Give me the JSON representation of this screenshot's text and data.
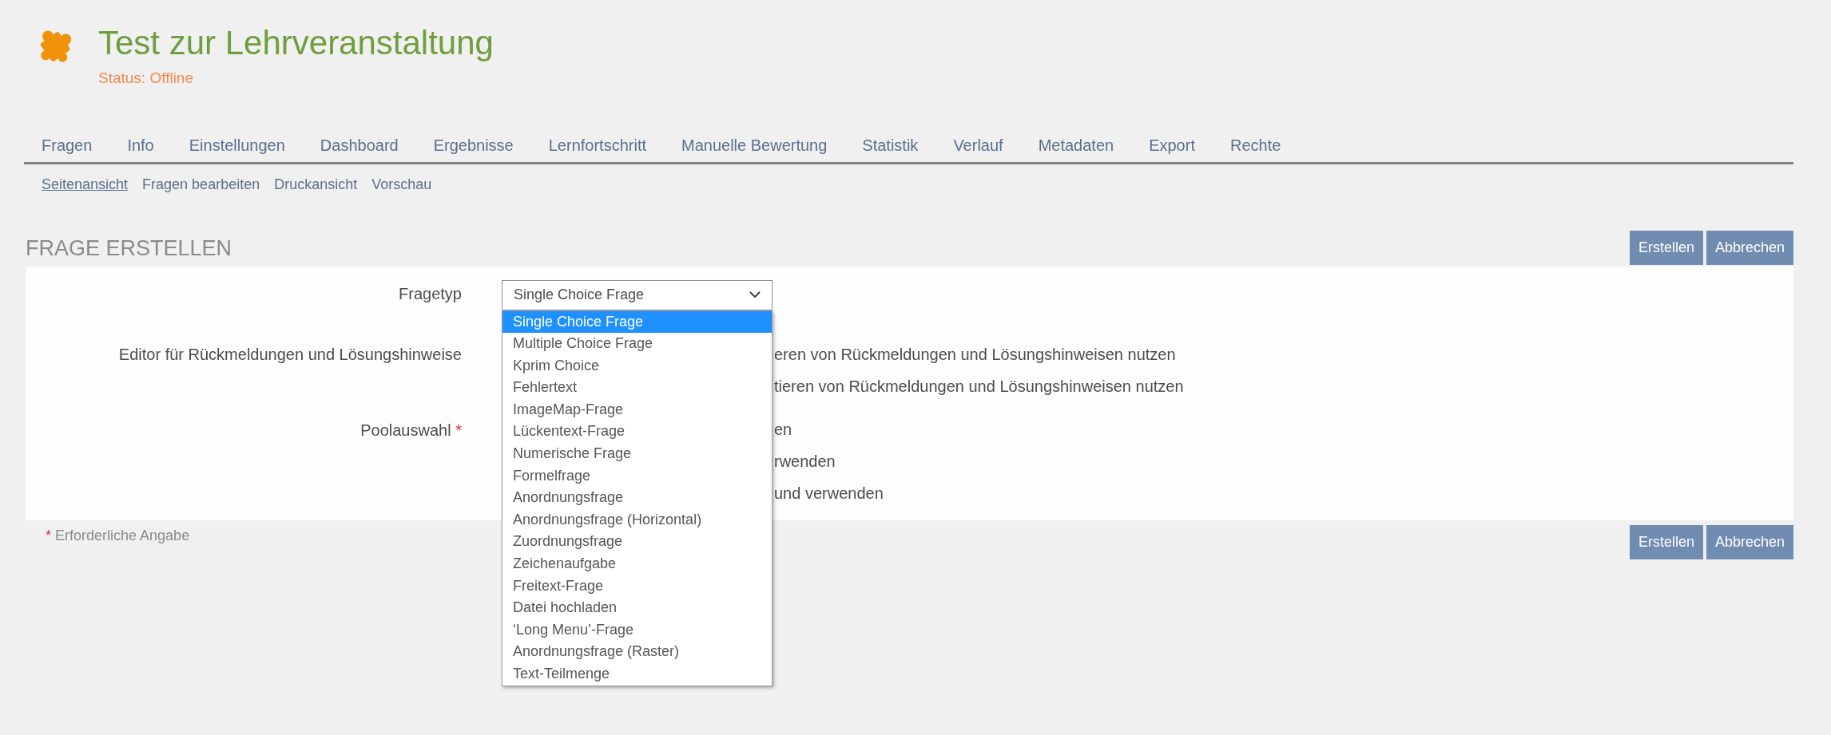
{
  "header": {
    "title": "Test zur Lehrveranstaltung",
    "status": "Status: Offline"
  },
  "tabs": [
    {
      "label": "Fragen"
    },
    {
      "label": "Info"
    },
    {
      "label": "Einstellungen"
    },
    {
      "label": "Dashboard"
    },
    {
      "label": "Ergebnisse"
    },
    {
      "label": "Lernfortschritt"
    },
    {
      "label": "Manuelle Bewertung"
    },
    {
      "label": "Statistik"
    },
    {
      "label": "Verlauf"
    },
    {
      "label": "Metadaten"
    },
    {
      "label": "Export"
    },
    {
      "label": "Rechte"
    }
  ],
  "subtabs": [
    {
      "label": "Seitenansicht",
      "selected": true
    },
    {
      "label": "Fragen bearbeiten",
      "selected": false
    },
    {
      "label": "Druckansicht",
      "selected": false
    },
    {
      "label": "Vorschau",
      "selected": false
    }
  ],
  "section": {
    "title": "FRAGE ERSTELLEN",
    "buttons": [
      "Erstellen",
      "Abbrechen"
    ]
  },
  "form": {
    "fields": [
      {
        "kind": "select",
        "label": "Fragetyp",
        "value": "Single Choice Frage",
        "options": [
          {
            "label": "Single Choice Frage",
            "selected": true
          },
          {
            "label": "Multiple Choice Frage",
            "selected": false
          },
          {
            "label": "Kprim Choice",
            "selected": false
          },
          {
            "label": "Fehlertext",
            "selected": false
          },
          {
            "label": "ImageMap-Frage",
            "selected": false
          },
          {
            "label": "Lückentext-Frage",
            "selected": false
          },
          {
            "label": "Numerische Frage",
            "selected": false
          },
          {
            "label": "Formelfrage",
            "selected": false
          },
          {
            "label": "Anordnungsfrage",
            "selected": false
          },
          {
            "label": "Anordnungsfrage (Horizontal)",
            "selected": false
          },
          {
            "label": "Zuordnungsfrage",
            "selected": false
          },
          {
            "label": "Zeichenaufgabe",
            "selected": false
          },
          {
            "label": "Freitext-Frage",
            "selected": false
          },
          {
            "label": "Datei hochladen",
            "selected": false
          },
          {
            "label": "‘Long Menu’-Frage",
            "selected": false
          },
          {
            "label": "Anordnungsfrage (Raster)",
            "selected": false
          },
          {
            "label": "Text-Teilmenge",
            "selected": false
          }
        ]
      },
      {
        "kind": "radios",
        "label": "Editor für Rückmeldungen und Lösungshinweise",
        "options": [
          "eren von Rückmeldungen und Lösungshinweisen nutzen",
          "tieren von Rückmeldungen und Lösungshinweisen nutzen"
        ]
      },
      {
        "kind": "radios",
        "label": "Poolauswahl",
        "required_mark": "*",
        "options": [
          "en",
          "rwenden",
          "und verwenden"
        ]
      }
    ]
  },
  "required_note": {
    "mark": "*",
    "text": "Erforderliche Angabe"
  },
  "bottom_buttons": [
    "Erstellen",
    "Abbrechen"
  ]
}
